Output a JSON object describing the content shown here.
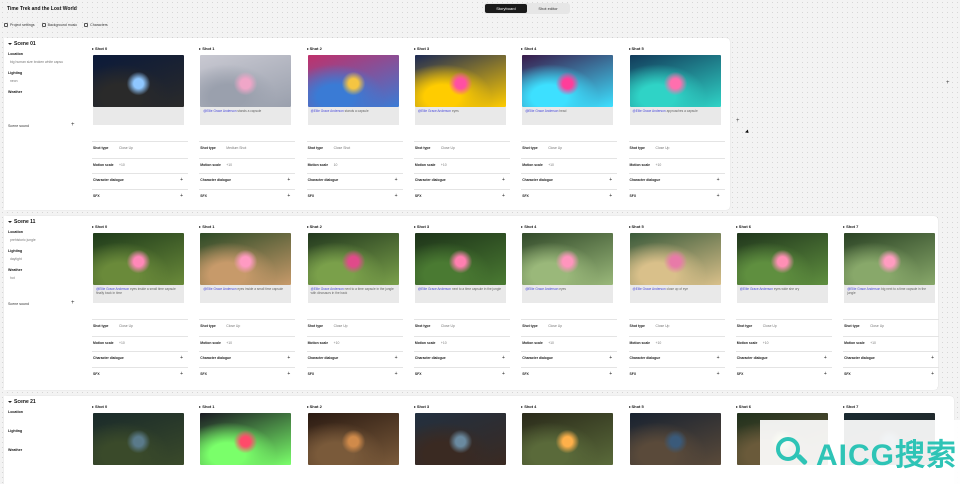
{
  "app": {
    "title": "Time Trek and the Lost World",
    "actions": [
      "Project settings",
      "Background music",
      "Characters"
    ],
    "view_tabs": [
      {
        "label": "Storyboard",
        "active": true
      },
      {
        "label": "Shot editor",
        "active": false
      }
    ]
  },
  "labels": {
    "location": "Location",
    "lighting": "Lighting",
    "weather": "Weather",
    "scene_sound": "Scene sound",
    "shot_type": "Shot type",
    "motion_scale": "Motion scale",
    "character_dialogue": "Character dialogue",
    "sfx": "SFX"
  },
  "scenes": [
    {
      "title": "Scene 01",
      "location": "big human size broken white capsu",
      "lighting": "neon",
      "weather": "",
      "shots": [
        {
          "title": "Shot 0",
          "caption_who": "",
          "caption": "",
          "shot_type": "Close Up",
          "motion": "+10",
          "colors": [
            "#0b1a3a",
            "#8fc7ff",
            "#2a2a2a"
          ]
        },
        {
          "title": "Shot 1",
          "caption_who": "@Ellie Grace Anderson",
          "caption": "stands a capsule",
          "shot_type": "Medium Shot",
          "motion": "+10",
          "colors": [
            "#c9c9d2",
            "#f0a6c8",
            "#9aa0ad"
          ]
        },
        {
          "title": "Shot 2",
          "caption_who": "@Ellie Grace Anderson",
          "caption": "stands a capsule",
          "shot_type": "Close Shot",
          "motion": "10",
          "colors": [
            "#c0306a",
            "#f5c542",
            "#3a7bd5"
          ]
        },
        {
          "title": "Shot 3",
          "caption_who": "@Ellie Grace Anderson",
          "caption": "eyes",
          "shot_type": "Close Up",
          "motion": "+10",
          "colors": [
            "#1d2a55",
            "#ff4fa3",
            "#ffcc00"
          ]
        },
        {
          "title": "Shot 4",
          "caption_who": "@Ellie Grace Anderson",
          "caption": "head",
          "shot_type": "Close Up",
          "motion": "+10",
          "colors": [
            "#3a1a4a",
            "#ff3d9a",
            "#3de0ff"
          ]
        },
        {
          "title": "Shot 5",
          "caption_who": "@Ellie Grace Anderson",
          "caption": "approaches a capsule",
          "shot_type": "Close Up",
          "motion": "+10",
          "colors": [
            "#123a5a",
            "#ff6fae",
            "#2fd3c6"
          ]
        }
      ]
    },
    {
      "title": "Scene 11",
      "location": "prehistoric jungle",
      "lighting": "daylight",
      "weather": "hot",
      "shots": [
        {
          "title": "Shot 0",
          "caption_who": "@Ellie Grace Anderson",
          "caption": "eyes inside a small time capsule finally back in time",
          "shot_type": "Close Up",
          "motion": "+10",
          "colors": [
            "#1e3a1a",
            "#ff88b8",
            "#6a8a3a"
          ]
        },
        {
          "title": "Shot 1",
          "caption_who": "@Ellie Grace Anderson",
          "caption": "eyes inside a small time capsule",
          "shot_type": "Close Up",
          "motion": "+10",
          "colors": [
            "#2d4a26",
            "#ff9ac2",
            "#c79a6a"
          ]
        },
        {
          "title": "Shot 2",
          "caption_who": "@Ellie Grace Anderson",
          "caption": "next to a time capsule in the jungle with dinosaurs in the back",
          "shot_type": "Close Up",
          "motion": "+10",
          "colors": [
            "#22381e",
            "#e04a8a",
            "#7aa04a"
          ]
        },
        {
          "title": "Shot 3",
          "caption_who": "@Ellie Grace Anderson",
          "caption": "next to a time capsule in the jungle",
          "shot_type": "Close Up",
          "motion": "+10",
          "colors": [
            "#1d3319",
            "#ff7fb0",
            "#4a7a32"
          ]
        },
        {
          "title": "Shot 4",
          "caption_who": "@Ellie Grace Anderson",
          "caption": "eyes",
          "shot_type": "Close Up",
          "motion": "+10",
          "colors": [
            "#324a2a",
            "#ff95bd",
            "#9ab87a"
          ]
        },
        {
          "title": "Shot 5",
          "caption_who": "@Ellie Grace Anderson",
          "caption": "close up of eye",
          "shot_type": "Close Up",
          "motion": "+10",
          "colors": [
            "#3a5a3a",
            "#e87aa8",
            "#d9c08a"
          ]
        },
        {
          "title": "Shot 6",
          "caption_who": "@Ellie Grace Anderson",
          "caption": "eyes wide she cry",
          "shot_type": "Close Up",
          "motion": "+10",
          "colors": [
            "#20361c",
            "#ff8fb5",
            "#5f8f3f"
          ]
        },
        {
          "title": "Shot 7",
          "caption_who": "@Ellie Grace Anderson",
          "caption": "big next to a time capsule in the jungle",
          "shot_type": "Close Up",
          "motion": "+10",
          "colors": [
            "#2a4224",
            "#ff9cc0",
            "#88a86a"
          ]
        }
      ]
    },
    {
      "title": "Scene 21",
      "location": "",
      "lighting": "",
      "weather": "",
      "shots": [
        {
          "title": "Shot 0",
          "colors": [
            "#1a2a2a",
            "#5a7a8a",
            "#3a4a2a"
          ]
        },
        {
          "title": "Shot 1",
          "colors": [
            "#1a1a22",
            "#ff4a6a",
            "#7aff6a"
          ]
        },
        {
          "title": "Shot 2",
          "colors": [
            "#2a1a12",
            "#d08a4a",
            "#7a5a3a"
          ]
        },
        {
          "title": "Shot 3",
          "colors": [
            "#223040",
            "#6a8aa0",
            "#3a2a22"
          ]
        },
        {
          "title": "Shot 4",
          "colors": [
            "#2a2a1a",
            "#ffb04a",
            "#5a6a3a"
          ]
        },
        {
          "title": "Shot 5",
          "colors": [
            "#182230",
            "#3a5a7a",
            "#5a4a3a"
          ]
        },
        {
          "title": "Shot 6",
          "colors": [
            "#20301c",
            "#aac06a",
            "#6a5a3a"
          ]
        },
        {
          "title": "Shot 7",
          "colors": [
            "#1a2a30",
            "#4a6a7a",
            "#2a2a2a"
          ]
        }
      ]
    }
  ],
  "watermark": {
    "text": "AICG搜索"
  }
}
